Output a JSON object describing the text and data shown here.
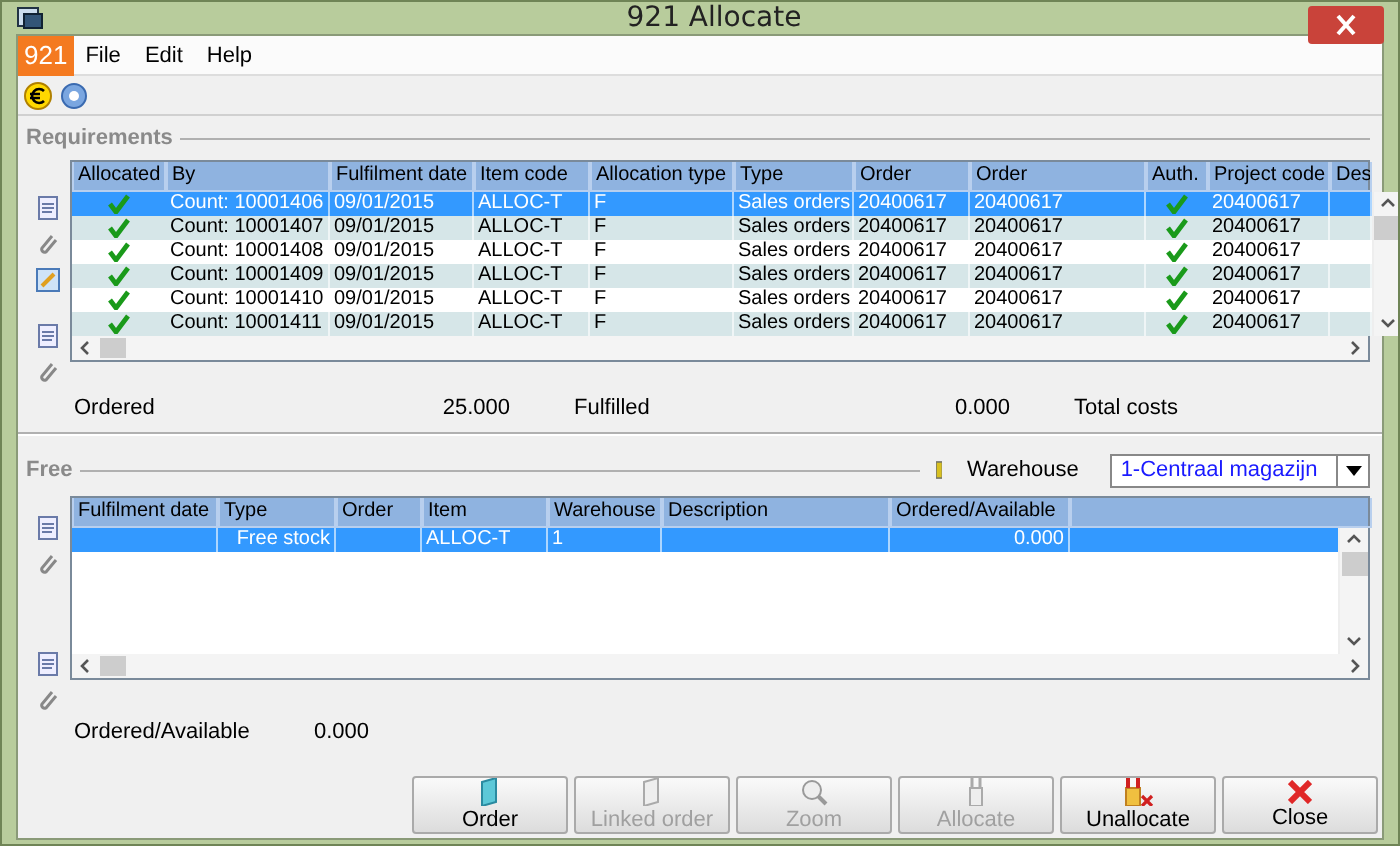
{
  "window": {
    "title": "921 Allocate"
  },
  "app_badge": "921",
  "menu": [
    "File",
    "Edit",
    "Help"
  ],
  "requirements": {
    "title": "Requirements",
    "columns": [
      {
        "label": "Allocated",
        "kind": "check"
      },
      {
        "label": "By",
        "kind": "text"
      },
      {
        "label": "Fulfilment date",
        "kind": "text"
      },
      {
        "label": "Item code",
        "kind": "text"
      },
      {
        "label": "Allocation type",
        "kind": "text"
      },
      {
        "label": "Type",
        "kind": "text"
      },
      {
        "label": "Order",
        "kind": "text"
      },
      {
        "label": "Order",
        "kind": "text"
      },
      {
        "label": "Auth.",
        "kind": "check"
      },
      {
        "label": "Project code",
        "kind": "text"
      },
      {
        "label": "Des",
        "kind": "text"
      }
    ],
    "rows": [
      {
        "selected": true,
        "cells": [
          true,
          "Count: 10001406",
          "09/01/2015",
          "ALLOC-T",
          "F",
          "Sales orders",
          "20400617",
          "20400617",
          true,
          "20400617"
        ]
      },
      {
        "selected": false,
        "cells": [
          true,
          "Count: 10001407",
          "09/01/2015",
          "ALLOC-T",
          "F",
          "Sales orders",
          "20400617",
          "20400617",
          true,
          "20400617"
        ]
      },
      {
        "selected": false,
        "cells": [
          true,
          "Count: 10001408",
          "09/01/2015",
          "ALLOC-T",
          "F",
          "Sales orders",
          "20400617",
          "20400617",
          true,
          "20400617"
        ]
      },
      {
        "selected": false,
        "cells": [
          true,
          "Count: 10001409",
          "09/01/2015",
          "ALLOC-T",
          "F",
          "Sales orders",
          "20400617",
          "20400617",
          true,
          "20400617"
        ]
      },
      {
        "selected": false,
        "cells": [
          true,
          "Count: 10001410",
          "09/01/2015",
          "ALLOC-T",
          "F",
          "Sales orders",
          "20400617",
          "20400617",
          true,
          "20400617"
        ]
      },
      {
        "selected": false,
        "cells": [
          true,
          "Count: 10001411",
          "09/01/2015",
          "ALLOC-T",
          "F",
          "Sales orders",
          "20400617",
          "20400617",
          true,
          "20400617"
        ]
      }
    ],
    "summary": [
      {
        "label": "Ordered",
        "value": "25.000"
      },
      {
        "label": "Fulfilled",
        "value": "0.000"
      },
      {
        "label": "Total costs"
      }
    ]
  },
  "free": {
    "title": "Free",
    "warehouse_label": "Warehouse",
    "warehouse_value": "1-Centraal magazijn",
    "columns": [
      {
        "label": "Fulfilment date"
      },
      {
        "label": "Type"
      },
      {
        "label": "Order"
      },
      {
        "label": "Item"
      },
      {
        "label": "Warehouse"
      },
      {
        "label": "Description"
      },
      {
        "label": "Ordered/Available"
      }
    ],
    "rows": [
      {
        "selected": true,
        "cells": [
          null,
          "Free stock",
          null,
          "ALLOC-T",
          "1",
          null,
          "0.000"
        ]
      }
    ],
    "summary": {
      "label": "Ordered/Available",
      "value": "0.000"
    }
  },
  "buttons": [
    {
      "label": "Order",
      "disabled": false
    },
    {
      "label": "Linked order",
      "disabled": true
    },
    {
      "label": "Zoom",
      "disabled": true
    },
    {
      "label": "Allocate",
      "disabled": true
    },
    {
      "label": "Unallocate",
      "disabled": false
    },
    {
      "label": "Close",
      "disabled": false
    }
  ]
}
